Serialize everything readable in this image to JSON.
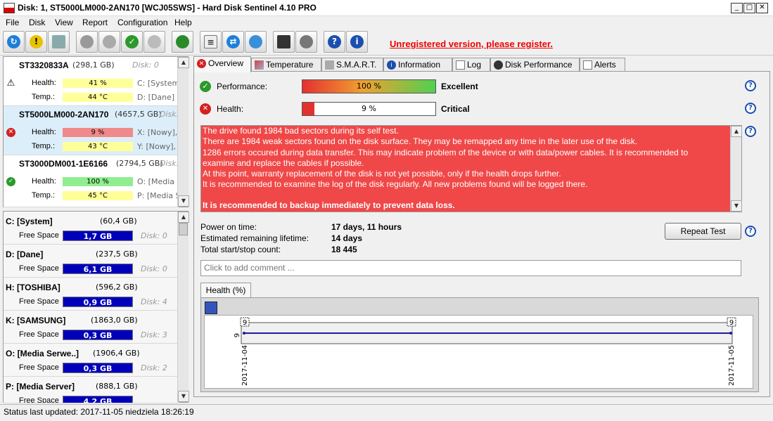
{
  "window": {
    "title": "Disk: 1, ST5000LM000-2AN170 [WCJ05SWS]  -  Hard Disk Sentinel 4.10 PRO"
  },
  "menu": [
    "File",
    "Disk",
    "View",
    "Report",
    "Configuration",
    "Help"
  ],
  "toolbar": {
    "unregistered": "Unregistered version, please register."
  },
  "disks": [
    {
      "model": "ST3320833A",
      "capacity": "(298,1 GB)",
      "disk_num": "Disk: 0",
      "status": "warning",
      "health_label": "Health:",
      "health": "41 %",
      "temp_label": "Temp.:",
      "temp": "44 °C",
      "drive1": "C: [System",
      "drive2": "D: [Dane]",
      "health_color": "#ffff9a",
      "temp_color": "#ffff9a"
    },
    {
      "model": "ST5000LM000-2AN170",
      "capacity": "(4657,5 GB)",
      "disk_num": "Disk:",
      "status": "critical",
      "health_label": "Health:",
      "health": "9 %",
      "temp_label": "Temp.:",
      "temp": "43 °C",
      "drive1": "X: [Nowy],",
      "drive2": "Y: [Nowy],",
      "health_color": "#f08a8a",
      "temp_color": "#ffff9a"
    },
    {
      "model": "ST3000DM001-1E6166",
      "capacity": "(2794,5 GB)",
      "disk_num": "Disk:",
      "status": "ok",
      "health_label": "Health:",
      "health": "100 %",
      "temp_label": "Temp.:",
      "temp": "45 °C",
      "drive1": "O: [Media",
      "drive2": "P: [Media S",
      "health_color": "#90ee90",
      "temp_color": "#ffff9a"
    }
  ],
  "volumes": [
    {
      "name": "C: [System]",
      "capacity": "(60,4 GB)",
      "fs_label": "Free Space",
      "free": "1,7 GB",
      "disk": "Disk: 0"
    },
    {
      "name": "D: [Dane]",
      "capacity": "(237,5 GB)",
      "fs_label": "Free Space",
      "free": "6,1 GB",
      "disk": "Disk: 0"
    },
    {
      "name": "H: [TOSHIBA]",
      "capacity": "(596,2 GB)",
      "fs_label": "Free Space",
      "free": "0,9 GB",
      "disk": "Disk: 4"
    },
    {
      "name": "K: [SAMSUNG]",
      "capacity": "(1863,0 GB)",
      "fs_label": "Free Space",
      "free": "0,3 GB",
      "disk": "Disk: 3"
    },
    {
      "name": "O: [Media Serwe..]",
      "capacity": "(1906,4 GB)",
      "fs_label": "Free Space",
      "free": "0,3 GB",
      "disk": "Disk: 2"
    },
    {
      "name": "P: [Media Server]",
      "capacity": "(888,1 GB)",
      "fs_label": "Free Space",
      "free": "4,2 GB",
      "disk": ""
    }
  ],
  "tabs": [
    "Overview",
    "Temperature",
    "S.M.A.R.T.",
    "Information",
    "Log",
    "Disk Performance",
    "Alerts"
  ],
  "overview": {
    "performance_label": "Performance:",
    "performance_value": "100 %",
    "performance_level": 1.0,
    "performance_verdict": "Excellent",
    "health_label": "Health:",
    "health_value": "9 %",
    "health_level": 0.09,
    "health_verdict": "Critical",
    "messages": [
      "The drive found 1984 bad sectors during its self test.",
      "There are 1984 weak sectors found on the disk surface. They may be remapped any time in the later use of the disk.",
      "1286 errors occured during data transfer. This may indicate problem of the device or with data/power cables. It is recommended to",
      "examine and replace the cables if possible.",
      "At this point, warranty replacement of the disk is not yet possible, only if the health drops further.",
      "It is recommended to examine the log of the disk regularly. All new problems found will be logged there."
    ],
    "backup_warning": "It is recommended to backup immediately to prevent data loss.",
    "power_on_label": "Power on time:",
    "power_on": "17 days, 11 hours",
    "lifetime_label": "Estimated remaining lifetime:",
    "lifetime": "14 days",
    "startstop_label": "Total start/stop count:",
    "startstop": "18 445",
    "repeat_test": "Repeat Test",
    "comment_placeholder": "Click to add comment ..."
  },
  "health_chart": {
    "tab_label": "Health (%)",
    "chart_data": {
      "type": "line",
      "x": [
        "2017-11-04",
        "2017-11-05"
      ],
      "series": [
        {
          "values": [
            9,
            9
          ]
        }
      ],
      "point_labels": [
        "9",
        "9"
      ],
      "ytick": "9"
    }
  },
  "status_bar": "Status last updated: 2017-11-05 niedziela 18:26:19",
  "colors": {
    "critical": "#f04848",
    "free_space": "#0000bb"
  }
}
